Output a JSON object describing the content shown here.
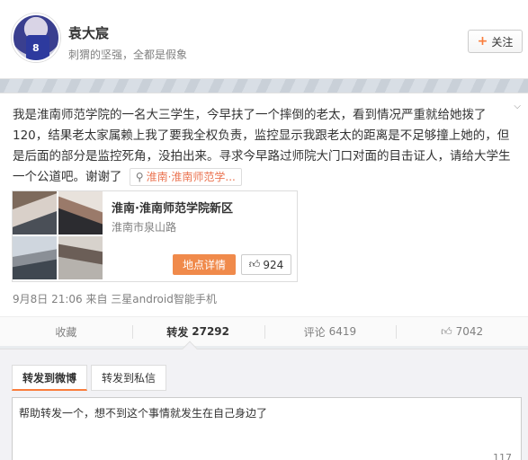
{
  "user": {
    "name": "袁大宸",
    "bio": "刺猬的坚强，全都是假象",
    "avatar_number": "8",
    "follow_label": "关注"
  },
  "post": {
    "text": "我是淮南师范学院的一名大三学生，今早扶了一个摔倒的老太，看到情况严重就给她拨了120，结果老太家属赖上我了要我全权负责，监控显示我跟老太的距离是不足够撞上她的，但是后面的部分是监控死角，没拍出来。寻求今早路过师院大门口对面的目击证人，请给大学生一个公道吧。谢谢了",
    "location_tag": "淮南·淮南师范学...",
    "place": {
      "title": "淮南·淮南师范学院新区",
      "address": "淮南市泉山路",
      "detail_label": "地点详情",
      "likes": "924"
    },
    "meta": "9月8日 21:06 来自 三星android智能手机"
  },
  "actions": [
    {
      "label": "收藏",
      "count": ""
    },
    {
      "label": "转发",
      "count": "27292"
    },
    {
      "label": "评论",
      "count": "6419"
    },
    {
      "label": "",
      "count": "7042"
    }
  ],
  "repost": {
    "tabs": [
      "转发到微博",
      "转发到私信"
    ],
    "draft": "帮助转发一个，想不到这个事情就发生在自己身边了",
    "remaining": "117"
  },
  "colors": {
    "accent": "#fa7d3c",
    "detail_button": "#f08a4b",
    "location_text": "#eb7350"
  }
}
